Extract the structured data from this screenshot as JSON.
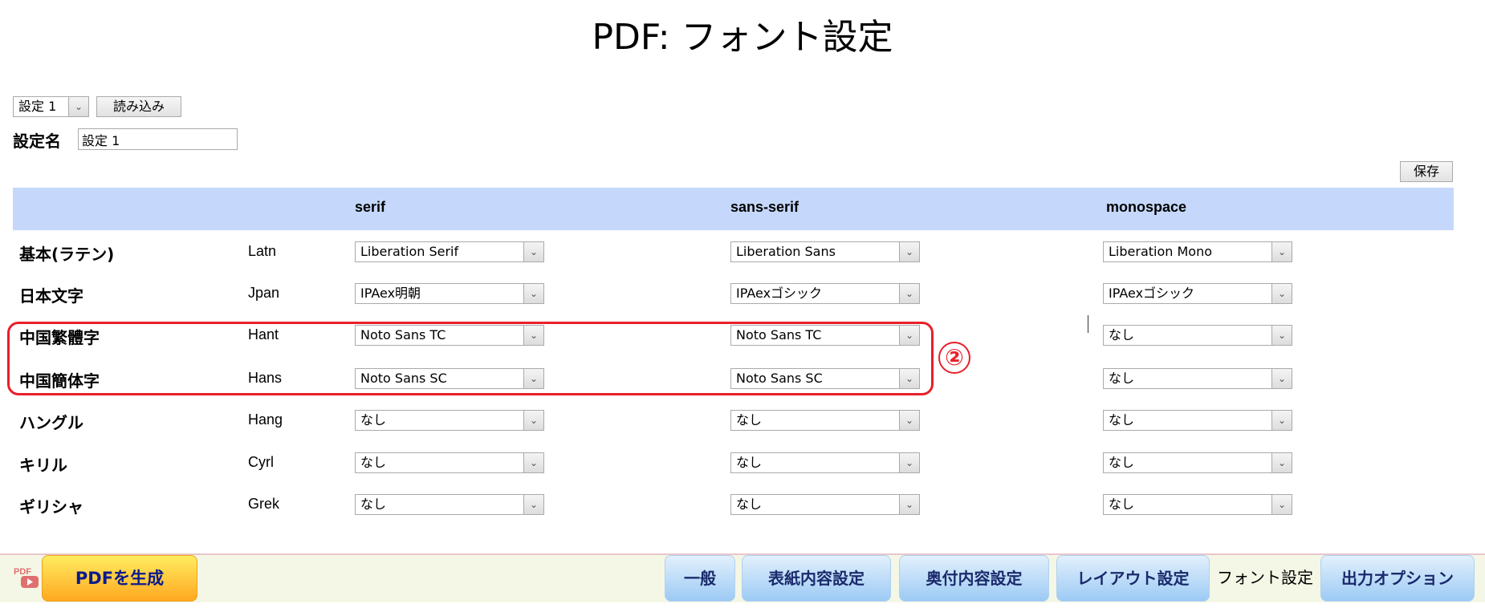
{
  "title": "PDF: フォント設定",
  "preset": {
    "selected": "設定 1",
    "load_label": "読み込み"
  },
  "setting_name": {
    "label": "設定名",
    "value": "設定 1"
  },
  "save_label": "保存",
  "columns": [
    "serif",
    "sans-serif",
    "monospace"
  ],
  "rows": [
    {
      "label": "基本(ラテン)",
      "code": "Latn",
      "serif": "Liberation Serif",
      "sans": "Liberation Sans",
      "mono": "Liberation Mono"
    },
    {
      "label": "日本文字",
      "code": "Jpan",
      "serif": "IPAex明朝",
      "sans": "IPAexゴシック",
      "mono": "IPAexゴシック"
    },
    {
      "label": "中国繁體字",
      "code": "Hant",
      "serif": "Noto Sans TC",
      "sans": "Noto Sans TC",
      "mono": "なし"
    },
    {
      "label": "中国簡体字",
      "code": "Hans",
      "serif": "Noto Sans SC",
      "sans": "Noto Sans SC",
      "mono": "なし"
    },
    {
      "label": "ハングル",
      "code": "Hang",
      "serif": "なし",
      "sans": "なし",
      "mono": "なし"
    },
    {
      "label": "キリル",
      "code": "Cyrl",
      "serif": "なし",
      "sans": "なし",
      "mono": "なし"
    },
    {
      "label": "ギリシャ",
      "code": "Grek",
      "serif": "なし",
      "sans": "なし",
      "mono": "なし"
    }
  ],
  "annotation": "②",
  "highlight_color": "#e8202a",
  "bottom": {
    "pdf_icon_text": "PDF",
    "generate_label": "PDFを生成",
    "tabs": [
      "一般",
      "表紙内容設定",
      "奥付内容設定",
      "レイアウト設定",
      "フォント設定",
      "出力オプション"
    ],
    "active_tab": "フォント設定"
  }
}
